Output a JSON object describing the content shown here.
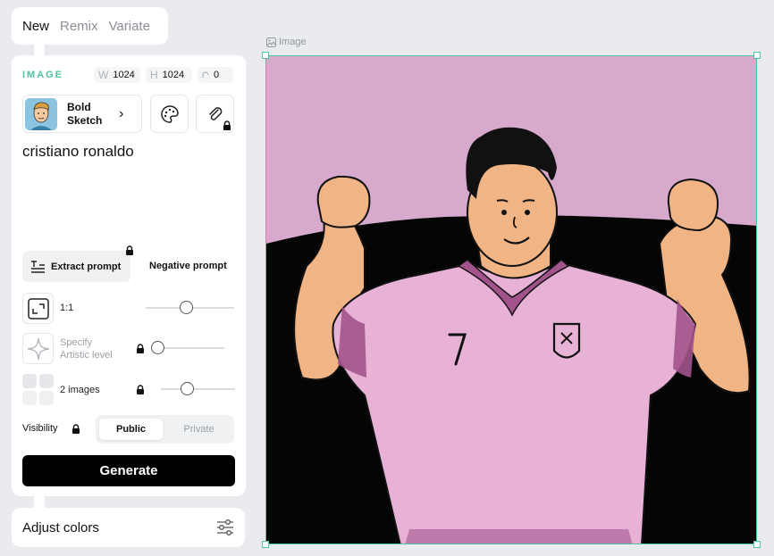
{
  "mode_tabs": [
    "New",
    "Remix",
    "Variate"
  ],
  "panel": {
    "section_label": "IMAGE",
    "width_key": "W",
    "width_value": "1024",
    "height_key": "H",
    "height_value": "1024",
    "seed_value": "0",
    "style": {
      "name": "Bold Sketch"
    },
    "prompt_text": "cristiano ronaldo",
    "extract_prompt_label": "Extract prompt",
    "negative_prompt_label": "Negative prompt",
    "aspect_ratio_label": "1:1",
    "artistic_level_label": "Specify Artistic level",
    "images_count_label": "2 images",
    "visibility_label": "Visibility",
    "visibility_options": [
      "Public",
      "Private"
    ],
    "visibility_selected": "Public",
    "generate_label": "Generate"
  },
  "adjust_colors_label": "Adjust colors",
  "canvas": {
    "caption": "Image"
  },
  "colors": {
    "accent": "#4cc4a4",
    "canvas_bg": "#d7a9cd",
    "jersey": "#e7b2d6",
    "skin": "#f1b485"
  }
}
